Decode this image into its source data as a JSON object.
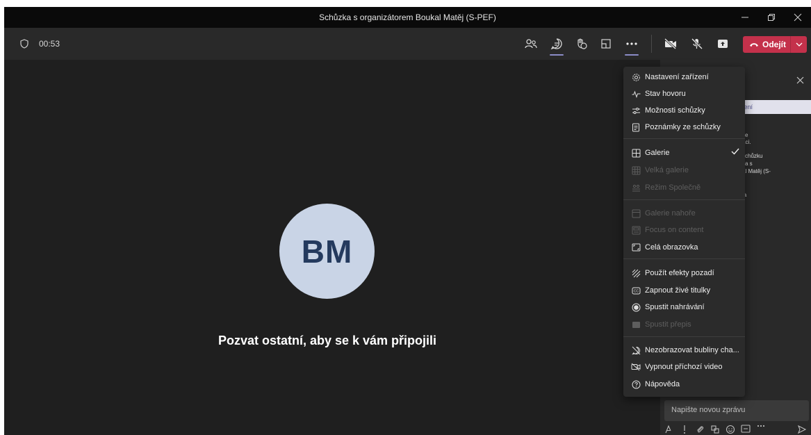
{
  "window": {
    "title": "Schůzka s organizátorem Boukal Matěj (S-PEF)"
  },
  "toolbar": {
    "timer": "00:53",
    "leave_label": "Odejít",
    "icons": [
      "people-icon",
      "chat-icon",
      "reactions-icon",
      "rooms-icon",
      "more-icon",
      "camera-off-icon",
      "mic-off-icon",
      "share-icon"
    ]
  },
  "stage": {
    "avatar_initials": "BM",
    "invite_text": "Pozvat ostatní, aby se k vám připojili"
  },
  "panel": {
    "banner": "stavení",
    "snippets": [
      "se",
      "aci.",
      "schůzku",
      "ka s",
      "al Matěj (S-",
      "la"
    ],
    "compose_placeholder": "Napište novou zprávu"
  },
  "menu": {
    "items": [
      {
        "label": "Nastavení zařízení",
        "icon": "gear-icon",
        "enabled": true
      },
      {
        "label": "Stav hovoru",
        "icon": "pulse-icon",
        "enabled": true
      },
      {
        "label": "Možnosti schůzky",
        "icon": "sliders-icon",
        "enabled": true
      },
      {
        "label": "Poznámky ze schůzky",
        "icon": "notes-icon",
        "enabled": true
      },
      {
        "label": "Galerie",
        "icon": "gallery-icon",
        "enabled": true,
        "checked": true
      },
      {
        "label": "Velká galerie",
        "icon": "large-gallery-icon",
        "enabled": false
      },
      {
        "label": "Režim Společně",
        "icon": "together-icon",
        "enabled": false
      },
      {
        "label": "Galerie nahoře",
        "icon": "gallery-top-icon",
        "enabled": false
      },
      {
        "label": "Focus on content",
        "icon": "focus-icon",
        "enabled": false
      },
      {
        "label": "Celá obrazovka",
        "icon": "fullscreen-icon",
        "enabled": true
      },
      {
        "label": "Použít efekty pozadí",
        "icon": "background-effects-icon",
        "enabled": true
      },
      {
        "label": "Zapnout živé titulky",
        "icon": "captions-icon",
        "enabled": true
      },
      {
        "label": "Spustit nahrávání",
        "icon": "record-icon",
        "enabled": true
      },
      {
        "label": "Spustit přepis",
        "icon": "transcript-icon",
        "enabled": false
      },
      {
        "label": "Nezobrazovat bubliny cha...",
        "icon": "chat-bubble-off-icon",
        "enabled": true
      },
      {
        "label": "Vypnout příchozí video",
        "icon": "video-off-icon",
        "enabled": true
      },
      {
        "label": "Nápověda",
        "icon": "help-icon",
        "enabled": true
      }
    ]
  },
  "colors": {
    "leave_button": "#c4314b",
    "active_indicator": "#8b8cc7",
    "avatar_bg": "#c9d4e6",
    "avatar_text": "#243a5e"
  }
}
